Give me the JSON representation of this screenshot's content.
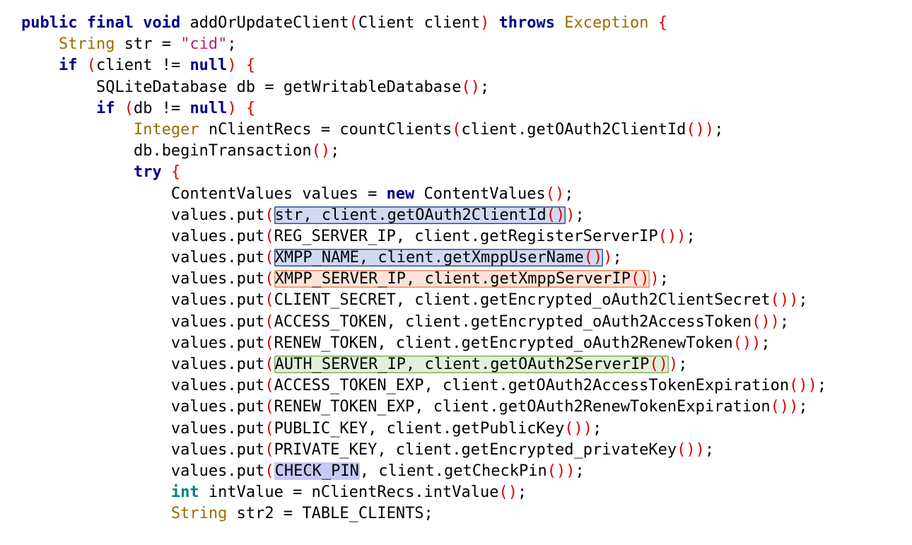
{
  "editor": {
    "lines": [
      {
        "indent": "",
        "tokens": [
          [
            "kw",
            "public"
          ],
          [
            "t",
            " "
          ],
          [
            "kw",
            "final"
          ],
          [
            "t",
            " "
          ],
          [
            "kw",
            "void"
          ],
          [
            "t",
            " addOrUpdateClient"
          ],
          [
            "p",
            "("
          ],
          [
            "t",
            "Client client"
          ],
          [
            "p",
            ")"
          ],
          [
            "t",
            " "
          ],
          [
            "kw",
            "throws"
          ],
          [
            "t",
            " "
          ],
          [
            "type",
            "Exception"
          ],
          [
            "t",
            " "
          ],
          [
            "p",
            "{"
          ]
        ]
      },
      {
        "indent": "    ",
        "tokens": [
          [
            "type",
            "String"
          ],
          [
            "t",
            " str = "
          ],
          [
            "str",
            "\"cid\""
          ],
          [
            "t",
            ";"
          ]
        ]
      },
      {
        "indent": "    ",
        "tokens": [
          [
            "kw",
            "if"
          ],
          [
            "t",
            " "
          ],
          [
            "p",
            "("
          ],
          [
            "t",
            "client != "
          ],
          [
            "kw",
            "null"
          ],
          [
            "p",
            ")"
          ],
          [
            "t",
            " "
          ],
          [
            "p",
            "{"
          ]
        ]
      },
      {
        "indent": "        ",
        "tokens": [
          [
            "t",
            "SQLiteDatabase db = getWritableDatabase"
          ],
          [
            "p",
            "()"
          ],
          [
            "t",
            ";"
          ]
        ]
      },
      {
        "indent": "        ",
        "tokens": [
          [
            "kw",
            "if"
          ],
          [
            "t",
            " "
          ],
          [
            "p",
            "("
          ],
          [
            "t",
            "db != "
          ],
          [
            "kw",
            "null"
          ],
          [
            "p",
            ")"
          ],
          [
            "t",
            " "
          ],
          [
            "p",
            "{"
          ]
        ]
      },
      {
        "indent": "            ",
        "tokens": [
          [
            "type",
            "Integer"
          ],
          [
            "t",
            " nClientRecs = countClients"
          ],
          [
            "p",
            "("
          ],
          [
            "t",
            "client.getOAuth2ClientId"
          ],
          [
            "p",
            "())"
          ],
          [
            "t",
            ";"
          ]
        ]
      },
      {
        "indent": "            ",
        "tokens": [
          [
            "t",
            "db.beginTransaction"
          ],
          [
            "p",
            "()"
          ],
          [
            "t",
            ";"
          ]
        ]
      },
      {
        "indent": "            ",
        "tokens": [
          [
            "kw",
            "try"
          ],
          [
            "t",
            " "
          ],
          [
            "p",
            "{"
          ]
        ]
      },
      {
        "indent": "                ",
        "tokens": [
          [
            "t",
            "ContentValues values = "
          ],
          [
            "kw",
            "new"
          ],
          [
            "t",
            " ContentValues"
          ],
          [
            "p",
            "()"
          ],
          [
            "t",
            ";"
          ]
        ]
      },
      {
        "indent": "                ",
        "tokens": [
          [
            "t",
            "values.put"
          ],
          [
            "p",
            "("
          ],
          [
            "hl-blue",
            [
              [
                "t",
                "str, client.getOAuth2ClientId"
              ],
              [
                "p",
                "()"
              ]
            ]
          ],
          [
            "p",
            ")"
          ],
          [
            "t",
            ";"
          ]
        ]
      },
      {
        "indent": "                ",
        "tokens": [
          [
            "t",
            "values.put"
          ],
          [
            "p",
            "("
          ],
          [
            "t",
            "REG_SERVER_IP, client.getRegisterServerIP"
          ],
          [
            "p",
            "())"
          ],
          [
            "t",
            ";"
          ]
        ]
      },
      {
        "indent": "                ",
        "tokens": [
          [
            "t",
            "values.put"
          ],
          [
            "p",
            "("
          ],
          [
            "hl-blue",
            [
              [
                "t",
                "XMPP_NAME, client.getXmppUserName"
              ],
              [
                "p",
                "()"
              ]
            ]
          ],
          [
            "p",
            ")"
          ],
          [
            "t",
            ";"
          ]
        ]
      },
      {
        "indent": "                ",
        "tokens": [
          [
            "t",
            "values.put"
          ],
          [
            "p",
            "("
          ],
          [
            "hl-orange",
            [
              [
                "t",
                "XMPP_SERVER_IP, client.getXmppServerIP"
              ],
              [
                "p",
                "()"
              ]
            ]
          ],
          [
            "p",
            ")"
          ],
          [
            "t",
            ";"
          ]
        ]
      },
      {
        "indent": "                ",
        "tokens": [
          [
            "t",
            "values.put"
          ],
          [
            "p",
            "("
          ],
          [
            "t",
            "CLIENT_SECRET, client.getEncrypted_oAuth2ClientSecret"
          ],
          [
            "p",
            "())"
          ],
          [
            "t",
            ";"
          ]
        ]
      },
      {
        "indent": "                ",
        "tokens": [
          [
            "t",
            "values.put"
          ],
          [
            "p",
            "("
          ],
          [
            "t",
            "ACCESS_TOKEN, client.getEncrypted_oAuth2AccessToken"
          ],
          [
            "p",
            "())"
          ],
          [
            "t",
            ";"
          ]
        ]
      },
      {
        "indent": "                ",
        "tokens": [
          [
            "t",
            "values.put"
          ],
          [
            "p",
            "("
          ],
          [
            "t",
            "RENEW_TOKEN, client.getEncrypted_oAuth2RenewToken"
          ],
          [
            "p",
            "())"
          ],
          [
            "t",
            ";"
          ]
        ]
      },
      {
        "indent": "                ",
        "tokens": [
          [
            "t",
            "values.put"
          ],
          [
            "p",
            "("
          ],
          [
            "hl-green",
            [
              [
                "t",
                "AUTH_SERVER_IP, client.getOAuth2ServerIP"
              ],
              [
                "p",
                "()"
              ]
            ]
          ],
          [
            "p",
            ")"
          ],
          [
            "t",
            ";"
          ]
        ]
      },
      {
        "indent": "                ",
        "tokens": [
          [
            "t",
            "values.put"
          ],
          [
            "p",
            "("
          ],
          [
            "t",
            "ACCESS_TOKEN_EXP, client.getOAuth2AccessTokenExpiration"
          ],
          [
            "p",
            "())"
          ],
          [
            "t",
            ";"
          ]
        ]
      },
      {
        "indent": "                ",
        "tokens": [
          [
            "t",
            "values.put"
          ],
          [
            "p",
            "("
          ],
          [
            "t",
            "RENEW_TOKEN_EXP, client.getOAuth2RenewTokenExpiration"
          ],
          [
            "p",
            "())"
          ],
          [
            "t",
            ";"
          ]
        ]
      },
      {
        "indent": "                ",
        "tokens": [
          [
            "t",
            "values.put"
          ],
          [
            "p",
            "("
          ],
          [
            "t",
            "PUBLIC_KEY, client.getPublicKey"
          ],
          [
            "p",
            "())"
          ],
          [
            "t",
            ";"
          ]
        ]
      },
      {
        "indent": "                ",
        "tokens": [
          [
            "t",
            "values.put"
          ],
          [
            "p",
            "("
          ],
          [
            "t",
            "PRIVATE_KEY, client.getEncrypted_privateKey"
          ],
          [
            "p",
            "())"
          ],
          [
            "t",
            ";"
          ]
        ]
      },
      {
        "indent": "                ",
        "tokens": [
          [
            "t",
            "values.put"
          ],
          [
            "p",
            "("
          ],
          [
            "hl-lav",
            [
              [
                "t",
                "CHECK_PIN"
              ]
            ]
          ],
          [
            "t",
            ", client.getCheckPin"
          ],
          [
            "p",
            "())"
          ],
          [
            "t",
            ";"
          ]
        ]
      },
      {
        "indent": "                ",
        "tokens": [
          [
            "kw2",
            "int"
          ],
          [
            "t",
            " intValue = nClientRecs.intValue"
          ],
          [
            "p",
            "()"
          ],
          [
            "t",
            ";"
          ]
        ]
      },
      {
        "indent": "                ",
        "tokens": [
          [
            "type",
            "String"
          ],
          [
            "t",
            " str2 = TABLE_CLIENTS;"
          ]
        ]
      }
    ]
  }
}
